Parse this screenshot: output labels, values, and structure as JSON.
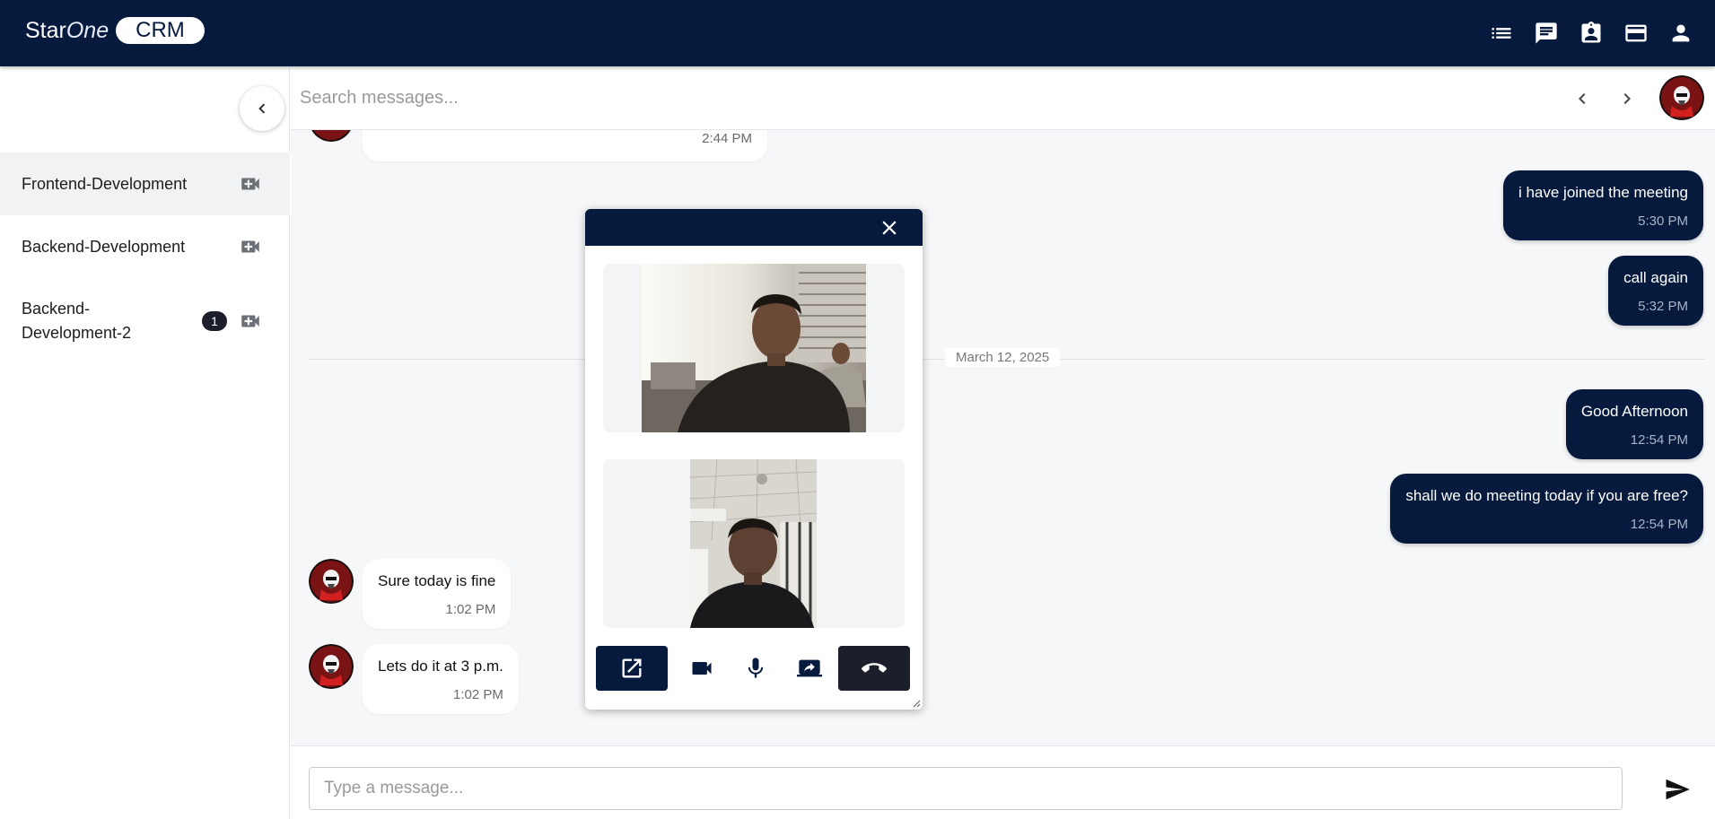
{
  "app": {
    "brand_star": "Star",
    "brand_one": "One",
    "brand_crm": "CRM"
  },
  "topnav": {
    "icons": [
      "list-icon",
      "chat-icon",
      "contact-badge-icon",
      "credit-card-icon",
      "user-icon"
    ]
  },
  "sidebar": {
    "groups": [
      {
        "label": "Frontend-Development",
        "badge": "",
        "active": true,
        "icon": "video-call-icon"
      },
      {
        "label": "Backend-Development",
        "badge": "",
        "active": false,
        "icon": "video-call-icon"
      },
      {
        "label": "Backend-Development-2",
        "badge": "1",
        "active": false,
        "icon": "video-call-icon"
      }
    ]
  },
  "search": {
    "placeholder": "Search messages..."
  },
  "messages": {
    "top_partial_time": "2:44 PM",
    "items": [
      {
        "direction": "out",
        "text": "i have joined the meeting",
        "time": "5:30 PM"
      },
      {
        "direction": "out",
        "text": "call again",
        "time": "5:32 PM"
      },
      {
        "direction": "out",
        "text": "Good Afternoon",
        "time": "12:54 PM"
      },
      {
        "direction": "out",
        "text": "shall we do meeting today if you are free?",
        "time": "12:54 PM"
      },
      {
        "direction": "in",
        "text": "Sure today is fine",
        "time": "1:02 PM"
      },
      {
        "direction": "in",
        "text": "Lets do it at 3 p.m.",
        "time": "1:02 PM"
      }
    ],
    "date_divider": "March 12, 2025"
  },
  "composer": {
    "placeholder": "Type a message..."
  },
  "call_popup": {
    "icons": [
      "close-icon",
      "open-in-new-icon",
      "videocam-icon",
      "mic-icon",
      "screen-share-icon",
      "call-end-icon"
    ]
  },
  "colors": {
    "navy": "#061a3e",
    "dark_button": "#1c1e2c",
    "chat_bg": "#f6f7f9"
  }
}
